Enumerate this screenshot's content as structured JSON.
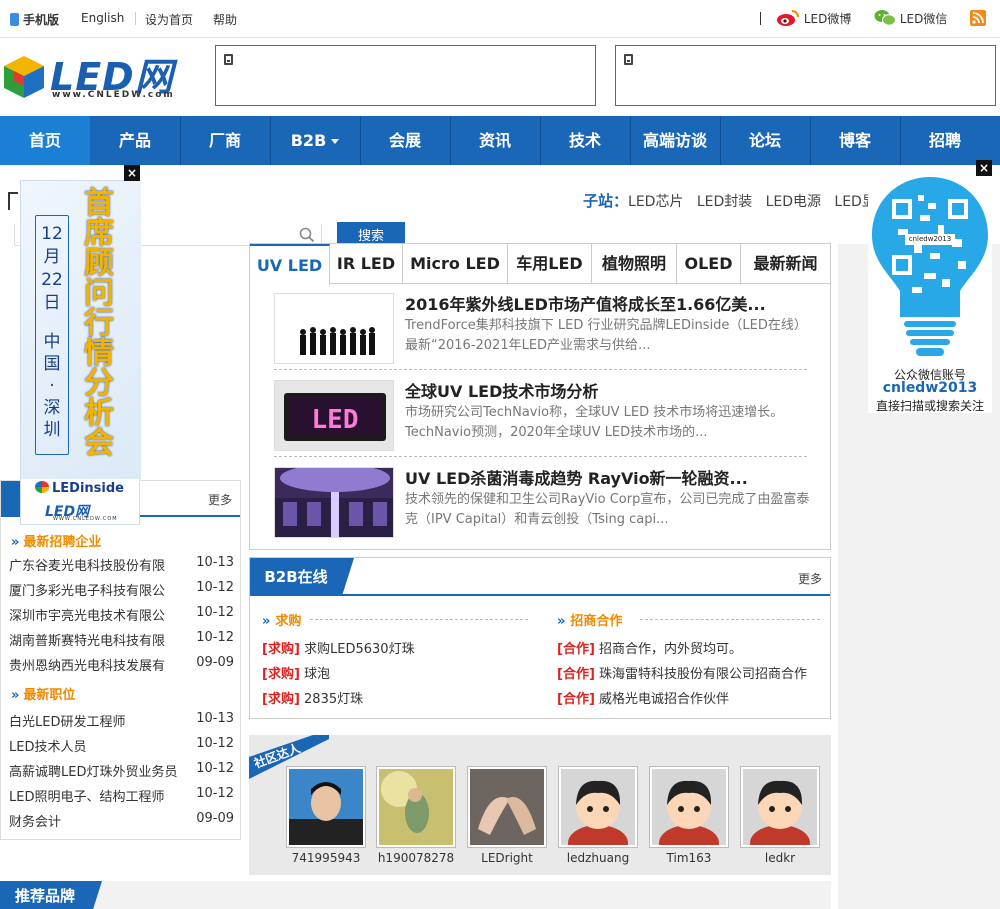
{
  "topbar": {
    "mobile": "手机版",
    "english": "English",
    "homepage": "设为首页",
    "help": "帮助",
    "weibo": "LED微博",
    "weixin": "LED微信"
  },
  "logo": {
    "text": "LED网",
    "url_text": "www.CNLEDW.com"
  },
  "nav": [
    {
      "label": "首页"
    },
    {
      "label": "产品"
    },
    {
      "label": "厂商"
    },
    {
      "label": "B2B"
    },
    {
      "label": "会展"
    },
    {
      "label": "资讯"
    },
    {
      "label": "技术"
    },
    {
      "label": "高端访谈"
    },
    {
      "label": "论坛"
    },
    {
      "label": "博客"
    },
    {
      "label": "招聘"
    }
  ],
  "subsites": {
    "label": "子站：",
    "items": [
      "LED芯片",
      "LED封装",
      "LED电源",
      "LED显"
    ]
  },
  "search": {
    "button": "搜索"
  },
  "left_ad": {
    "date": "12月22日",
    "place": "中国·深圳",
    "title": "首席顾问行情分析会",
    "brand1": "LEDinside",
    "brand2": "LED网",
    "brand2_url": "WWW.CNLEDW.COM",
    "close": "×"
  },
  "tabs": [
    {
      "label": "UV LED"
    },
    {
      "label": "IR LED"
    },
    {
      "label": "Micro LED"
    },
    {
      "label": "车用LED"
    },
    {
      "label": "植物照明"
    },
    {
      "label": "OLED"
    },
    {
      "label": "最新新闻"
    }
  ],
  "news": [
    {
      "title": "2016年紫外线LED市场产值将成长至1.66亿美...",
      "desc": "TrendForce集邦科技旗下 LED 行业研究品牌LEDinside（LED在线）最新“2016-2021年LED产业需求与供给..."
    },
    {
      "title": "全球UV LED技术市场分析",
      "desc": "市场研究公司TechNavio称，全球UV LED 技术市场将迅速增长。TechNavio预测，2020年全球UV LED技术市场的..."
    },
    {
      "title": "UV LED杀菌消毒成趋势 RayVio新一轮融资...",
      "desc": "技术领先的保健和卫生公司RayVio Corp宣布，公司已完成了由盈富泰克（IPV Capital）和青云创投（Tsing capi..."
    }
  ],
  "left_list": {
    "head_more": "更多",
    "section1": "最新招聘企业",
    "companies": [
      {
        "name": "广东谷麦光电科技股份有限",
        "date": "10-13"
      },
      {
        "name": "厦门多彩光电子科技有限公",
        "date": "10-12"
      },
      {
        "name": "深圳市宇亮光电技术有限公",
        "date": "10-12"
      },
      {
        "name": "湖南普斯赛特光电科技有限",
        "date": "10-12"
      },
      {
        "name": "贵州恩纳西光电科技发展有",
        "date": "09-09"
      }
    ],
    "section2": "最新职位",
    "jobs": [
      {
        "name": "白光LED研发工程师",
        "date": "10-13"
      },
      {
        "name": "LED技术人员",
        "date": "10-12"
      },
      {
        "name": "高薪诚聘LED灯珠外贸业务员",
        "date": "10-12"
      },
      {
        "name": "LED照明电子、结构工程师",
        "date": "10-12"
      },
      {
        "name": "财务会计",
        "date": "09-09"
      }
    ]
  },
  "b2b": {
    "title": "B2B在线",
    "more": "更多",
    "buy_head": "求购",
    "coop_head": "招商合作",
    "buy": [
      {
        "tag": "[求购]",
        "text": "求购LED5630灯珠"
      },
      {
        "tag": "[求购]",
        "text": "球泡"
      },
      {
        "tag": "[求购]",
        "text": "2835灯珠"
      }
    ],
    "coop": [
      {
        "tag": "[合作]",
        "text": "招商合作，内外贸均可。"
      },
      {
        "tag": "[合作]",
        "text": "珠海雷特科技股份有限公司招商合作"
      },
      {
        "tag": "[合作]",
        "text": "威格光电诚招合作伙伴"
      }
    ]
  },
  "community": {
    "title": "社区达人",
    "users": [
      {
        "name": "741995943"
      },
      {
        "name": "h190078278"
      },
      {
        "name": "LEDright"
      },
      {
        "name": "ledzhuang"
      },
      {
        "name": "Tim163"
      },
      {
        "name": "ledkr"
      }
    ]
  },
  "brand_section": {
    "title": "推荐品牌"
  },
  "qr": {
    "label1": "公众微信账号",
    "account": "cnledw2013",
    "label2": "直接扫描或搜索关注",
    "inner": "cnledw2013",
    "close": "×"
  },
  "colors": {
    "nav": "#1a67b7",
    "nav_active": "#1b7fd6",
    "accent_orange": "#f08a00",
    "buy_red": "#dd2222"
  }
}
